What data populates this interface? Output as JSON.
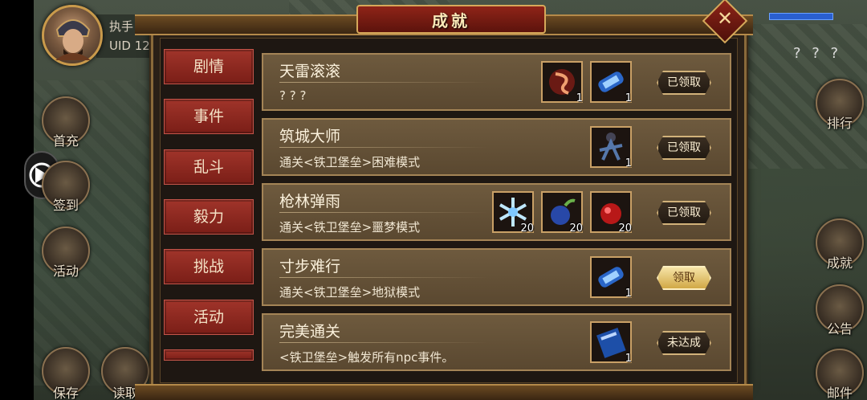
{
  "window": {
    "title": "成就",
    "close_label": "✕"
  },
  "player": {
    "name": "执手",
    "uid": "UID  12"
  },
  "top_right": {
    "question_marks": "? ? ?"
  },
  "left_menu": [
    {
      "label": "首充"
    },
    {
      "label": "签到"
    },
    {
      "label": "活动"
    },
    {
      "label": "保存"
    },
    {
      "label": "读取"
    }
  ],
  "right_menu": [
    {
      "label": "排行"
    },
    {
      "label": "成就"
    },
    {
      "label": "公告"
    },
    {
      "label": "邮件"
    }
  ],
  "tabs": [
    {
      "label": "剧情"
    },
    {
      "label": "事件"
    },
    {
      "label": "乱斗"
    },
    {
      "label": "毅力"
    },
    {
      "label": "挑战"
    },
    {
      "label": "活动"
    }
  ],
  "achievements": [
    {
      "title": "天雷滚滚",
      "desc": "? ? ?",
      "rewards": [
        {
          "icon": "firework-icon",
          "count": "1"
        },
        {
          "icon": "scroll-icon",
          "count": "1"
        }
      ],
      "button": "已领取",
      "state": "claimed"
    },
    {
      "title": "筑城大师",
      "desc": "通关<铁卫堡垒>困难模式",
      "rewards": [
        {
          "icon": "soldier-icon",
          "count": "1"
        }
      ],
      "button": "已领取",
      "state": "claimed"
    },
    {
      "title": "枪林弹雨",
      "desc": "通关<铁卫堡垒>噩梦模式",
      "rewards": [
        {
          "icon": "ice-crystal-icon",
          "count": "20"
        },
        {
          "icon": "blue-bomb-icon",
          "count": "20"
        },
        {
          "icon": "red-bomb-icon",
          "count": "20"
        }
      ],
      "button": "已领取",
      "state": "claimed"
    },
    {
      "title": "寸步难行",
      "desc": "通关<铁卫堡垒>地狱模式",
      "rewards": [
        {
          "icon": "scroll-icon",
          "count": "1"
        }
      ],
      "button": "领取",
      "state": "claimable"
    },
    {
      "title": "完美通关",
      "desc": "<铁卫堡垒>触发所有npc事件。",
      "rewards": [
        {
          "icon": "book-icon",
          "count": "1"
        }
      ],
      "button": "未达成",
      "state": "incomplete"
    }
  ],
  "colors": {
    "panel_border": "#8a6a3a",
    "tab_red": "#a0342a",
    "row_bg": "#6e5a3e",
    "claim_gold": "#d1a846"
  }
}
